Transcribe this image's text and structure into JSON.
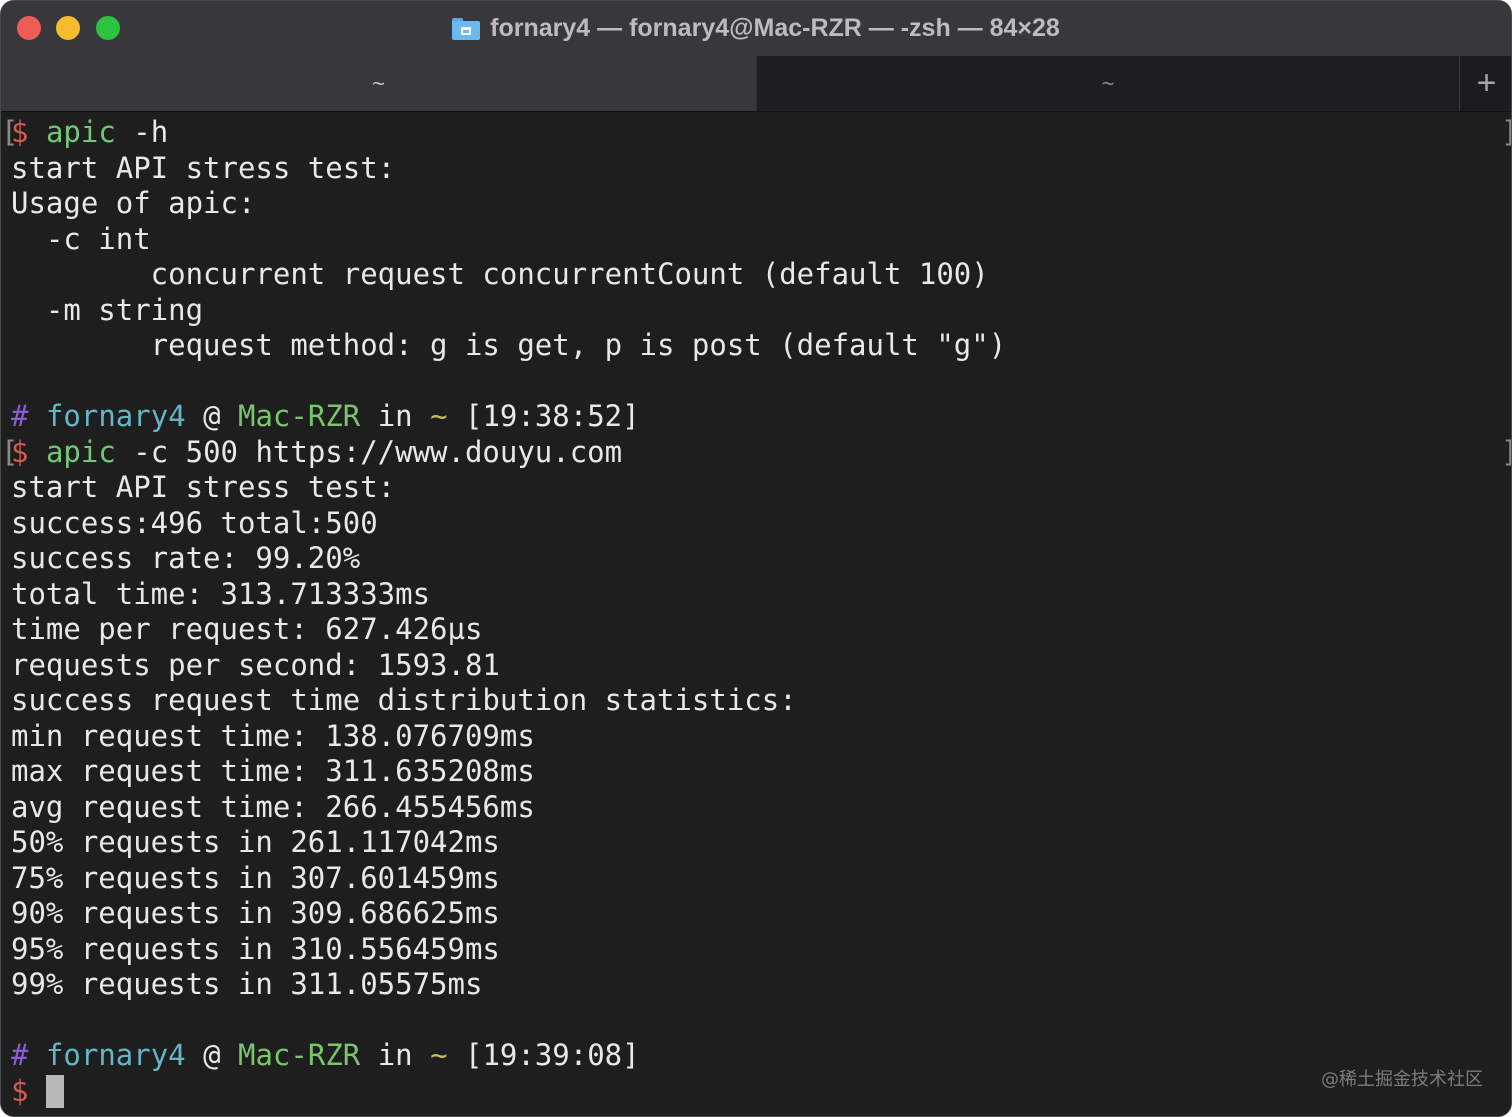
{
  "window": {
    "title": "fornary4 — fornary4@Mac-RZR — -zsh — 84×28",
    "tabs": [
      {
        "label": "~",
        "active": true
      },
      {
        "label": "~",
        "active": false
      }
    ],
    "new_tab_label": "+"
  },
  "terminal": {
    "lines": [
      {
        "prompt": "$",
        "cmd": "apic",
        "args": " -h"
      },
      {
        "text": "start API stress test:"
      },
      {
        "text": "Usage of apic:"
      },
      {
        "text": "  -c int"
      },
      {
        "text": "        concurrent request concurrentCount (default 100)"
      },
      {
        "text": "  -m string"
      },
      {
        "text": "        request method: g is get, p is post (default \"g\")"
      },
      {
        "text": ""
      },
      {
        "hash": "#",
        "user": "fornary4",
        "at": " @ ",
        "host": "Mac-RZR",
        "in": " in ",
        "dir": "~",
        "time": " [19:38:52]"
      },
      {
        "prompt": "$",
        "cmd": "apic",
        "args": " -c 500 https://www.douyu.com"
      },
      {
        "text": "start API stress test:"
      },
      {
        "text": "success:496 total:500"
      },
      {
        "text": "success rate: 99.20%"
      },
      {
        "text": "total time: 313.713333ms"
      },
      {
        "text": "time per request: 627.426µs"
      },
      {
        "text": "requests per second: 1593.81"
      },
      {
        "text": "success request time distribution statistics:"
      },
      {
        "text": "min request time: 138.076709ms"
      },
      {
        "text": "max request time: 311.635208ms"
      },
      {
        "text": "avg request time: 266.455456ms"
      },
      {
        "text": "50% requests in 261.117042ms"
      },
      {
        "text": "75% requests in 307.601459ms"
      },
      {
        "text": "90% requests in 309.686625ms"
      },
      {
        "text": "95% requests in 310.556459ms"
      },
      {
        "text": "99% requests in 311.05575ms"
      },
      {
        "text": ""
      },
      {
        "hash": "#",
        "user": "fornary4",
        "at": " @ ",
        "host": "Mac-RZR",
        "in": " in ",
        "dir": "~",
        "time": " [19:39:08]"
      },
      {
        "prompt": "$",
        "cursor": true
      }
    ],
    "mark_left": "[",
    "mark_right": "]"
  },
  "watermark": "@稀土掘金技术社区",
  "colors": {
    "prompt": "#d05d51",
    "command": "#74c77a",
    "hash": "#8e5bd8",
    "user": "#64b5c5",
    "host": "#79c56a",
    "dir": "#c8bc5c"
  }
}
